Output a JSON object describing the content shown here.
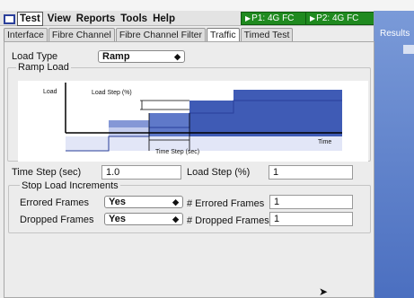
{
  "menu": {
    "items": [
      "Test",
      "View",
      "Reports",
      "Tools",
      "Help"
    ],
    "ports": [
      "P1: 4G FC",
      "P2: 4G FC"
    ]
  },
  "tabs": [
    "Interface",
    "Fibre Channel",
    "Fibre Channel Filter",
    "Traffic",
    "Timed Test"
  ],
  "results_panel": {
    "label": "Results"
  },
  "traffic": {
    "load_type_label": "Load Type",
    "load_type_value": "Ramp",
    "group_label": "Ramp Load",
    "chart": {
      "y_label": "Load",
      "x_label": "Time",
      "load_step_label": "Load Step (%)",
      "time_step_label": "Time Step (sec)"
    },
    "time_step_label": "Time Step (sec)",
    "time_step_value": "1.0",
    "load_step_label": "Load Step (%)",
    "load_step_value": "1",
    "stop_group_label": "Stop Load Increments",
    "errored_frames_label": "Errored Frames",
    "errored_frames_value": "Yes",
    "num_errored_label": "# Errored Frames",
    "num_errored_value": "1",
    "dropped_frames_label": "Dropped Frames",
    "dropped_frames_value": "Yes",
    "num_dropped_label": "# Dropped Frames",
    "num_dropped_value": "1"
  },
  "colors": {
    "ramp_dark": "#3f5bb5",
    "ramp_mid": "#8497d6",
    "ramp_light": "#c4cdee",
    "ramp_base": "#e2e6f7",
    "port_green": "#1f8a1f"
  }
}
